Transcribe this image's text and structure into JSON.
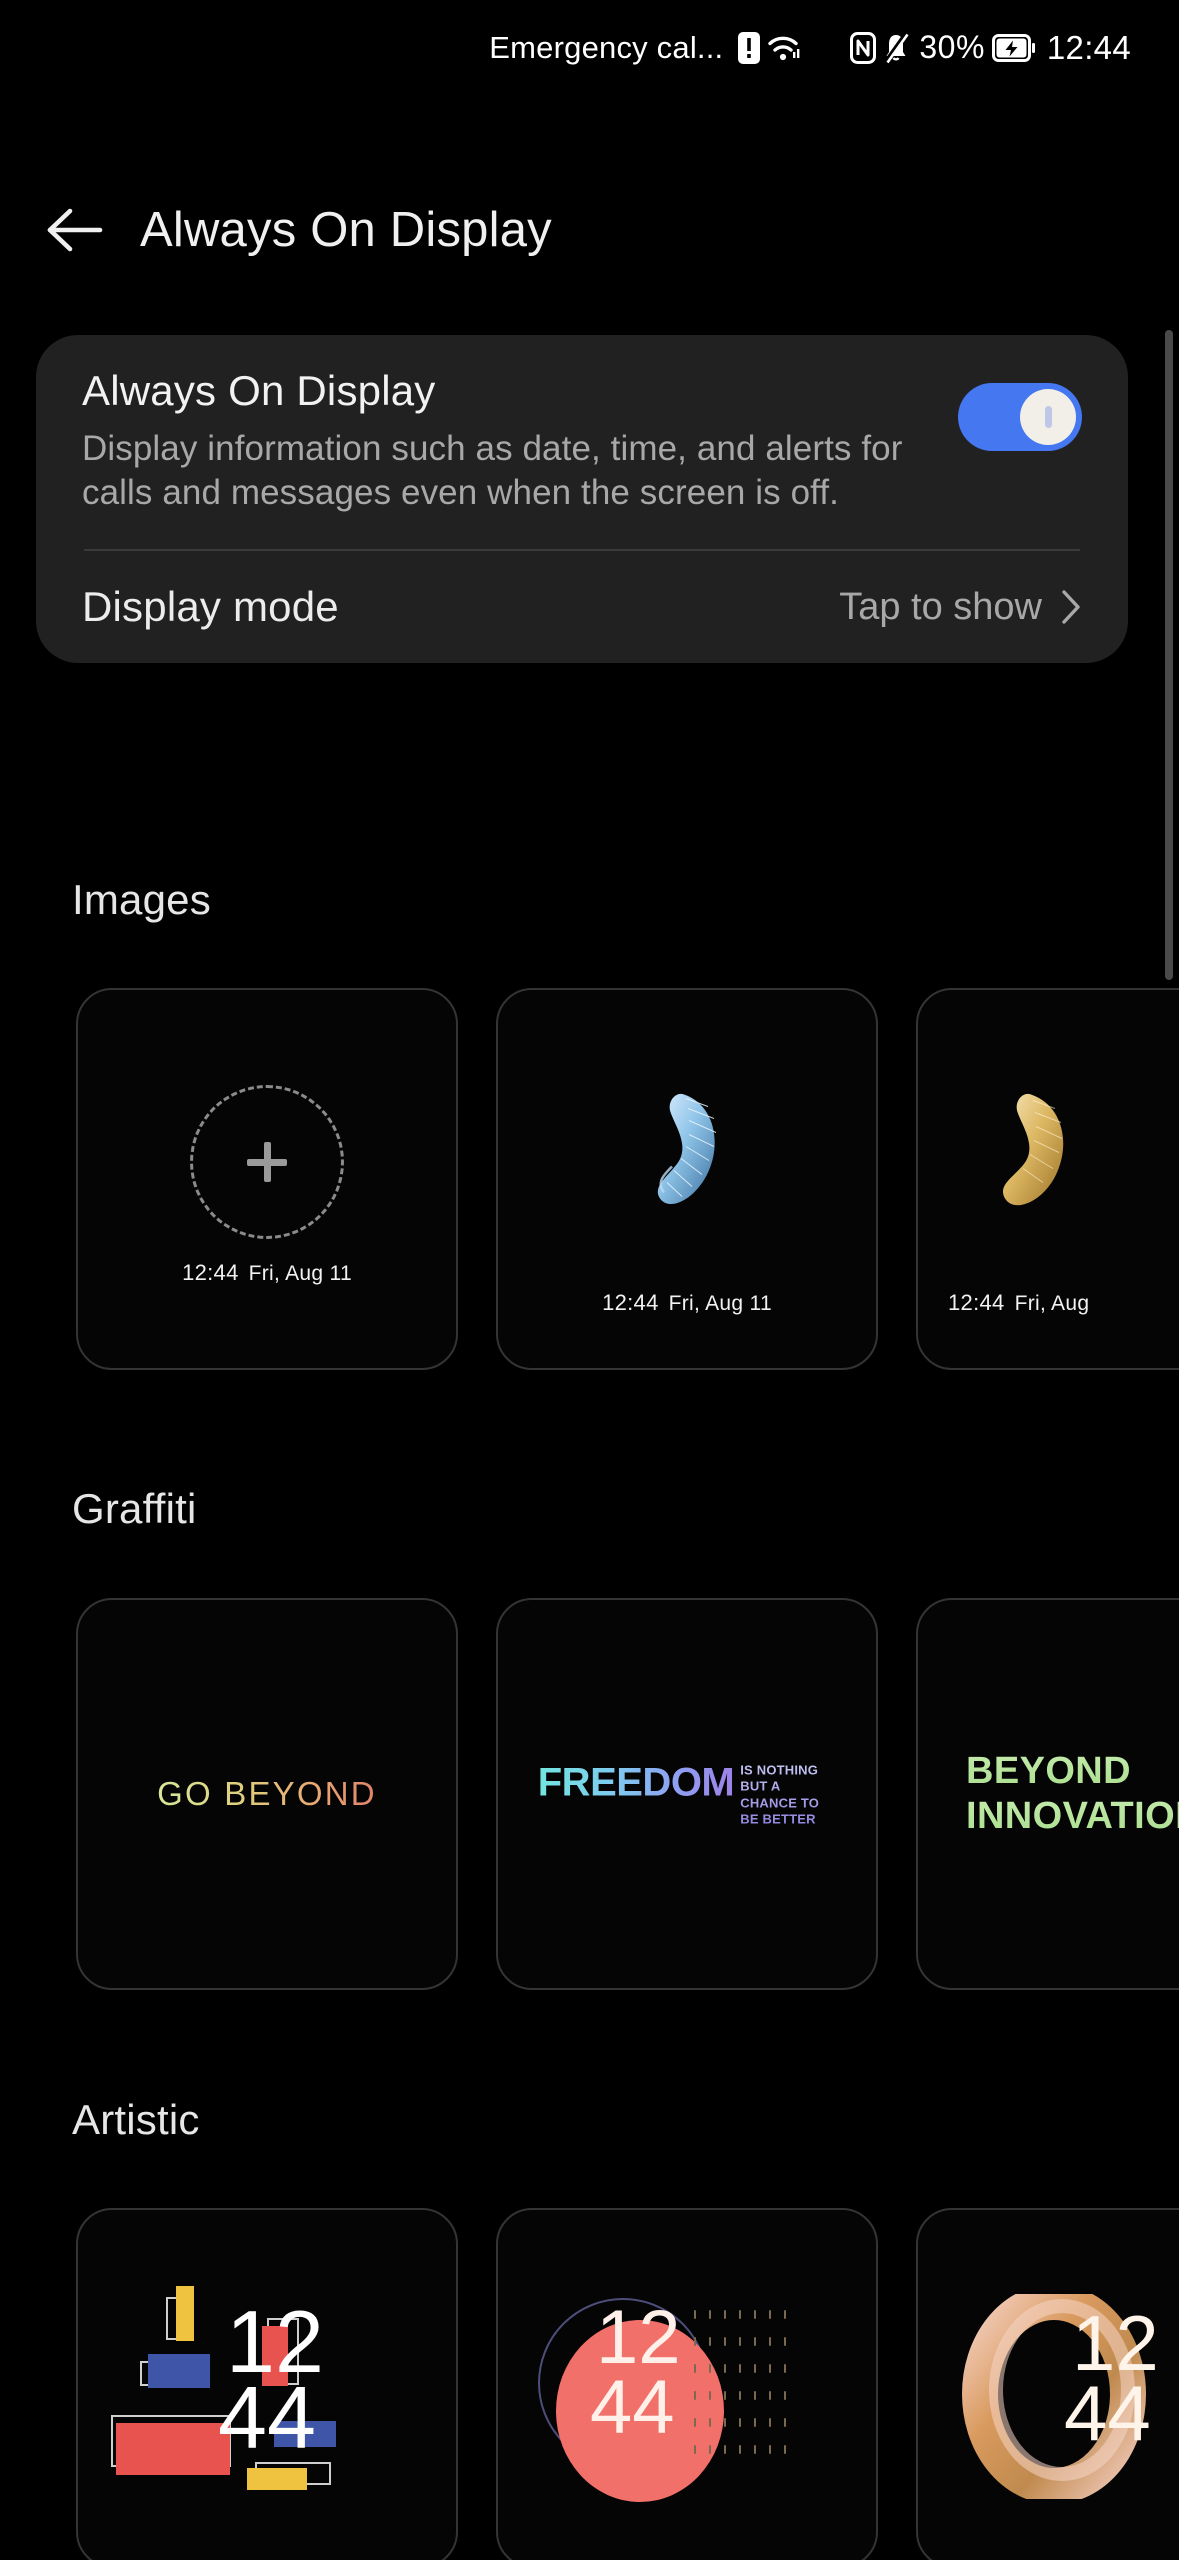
{
  "status_bar": {
    "carrier": "Emergency cal...",
    "icons": [
      "alert-icon",
      "wifi-icon",
      "nfc-icon",
      "mute-icon",
      "battery-charging-icon"
    ],
    "battery_percent": "30%",
    "clock": "12:44"
  },
  "header": {
    "back": "back-arrow-icon",
    "title": "Always On Display"
  },
  "aod_card": {
    "title": "Always On Display",
    "description": "Display information such as date, time, and alerts for calls and messages even when the screen is off.",
    "toggle_state": "on",
    "toggle_color": "#4477f0",
    "display_mode_label": "Display mode",
    "display_mode_value": "Tap to show"
  },
  "sections": [
    {
      "title": "Images",
      "tiles": [
        {
          "type": "add",
          "clock": "12:44",
          "date": "Fri, Aug 11",
          "art": "plus-circle"
        },
        {
          "type": "image",
          "clock": "12:44",
          "date": "Fri, Aug 11",
          "art": "blue-ribbon"
        },
        {
          "type": "image",
          "clock": "12:44",
          "date": "Fri, Aug",
          "art": "gold-ribbon"
        }
      ]
    },
    {
      "title": "Graffiti",
      "tiles": [
        {
          "type": "text",
          "text": "GO BEYOND",
          "colors": [
            "#d6e89a",
            "#e0826a"
          ]
        },
        {
          "type": "text",
          "text": "FREEDOM",
          "sub": "IS NOTHING BUT A CHANCE TO BE BETTER",
          "colors": [
            "#72e6e0",
            "#9d82e8"
          ]
        },
        {
          "type": "text",
          "line1": "BEYOND",
          "line2": "INNOVATION",
          "colors": [
            "#c6ecae",
            "#a8dd8c"
          ]
        }
      ]
    },
    {
      "title": "Artistic",
      "tiles": [
        {
          "type": "mondrian",
          "hours": "12",
          "minutes": "44"
        },
        {
          "type": "red-circle",
          "hours": "12",
          "minutes": "44"
        },
        {
          "type": "gold-ring",
          "hours": "12",
          "minutes": "44"
        }
      ]
    }
  ]
}
